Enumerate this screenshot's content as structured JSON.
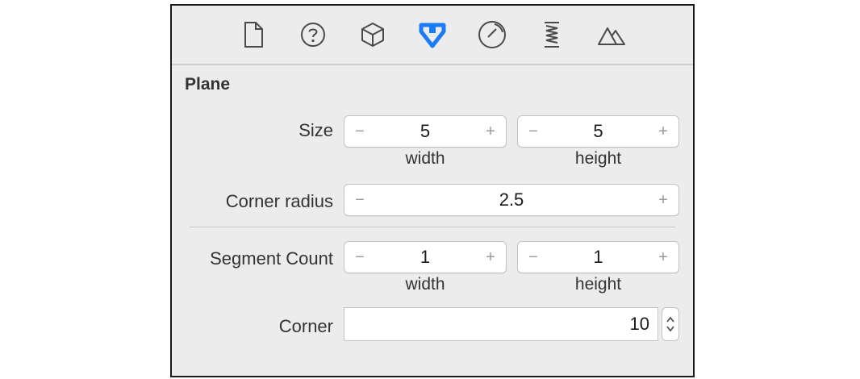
{
  "toolbar": {
    "tabs": [
      {
        "icon": "file-icon",
        "active": false
      },
      {
        "icon": "help-icon",
        "active": false
      },
      {
        "icon": "cube-icon",
        "active": false
      },
      {
        "icon": "attributes-arrow-icon",
        "active": true
      },
      {
        "icon": "sphere-icon",
        "active": false
      },
      {
        "icon": "physics-spring-icon",
        "active": false
      },
      {
        "icon": "scene-mountain-icon",
        "active": false
      }
    ],
    "active_color": "#1a7cf5",
    "icon_color": "#4a4a4a"
  },
  "section": {
    "title": "Plane"
  },
  "size": {
    "label": "Size",
    "width_value": "5",
    "height_value": "5",
    "width_label": "width",
    "height_label": "height",
    "minus": "−",
    "plus": "+"
  },
  "corner_radius": {
    "label": "Corner radius",
    "value": "2.5",
    "minus": "−",
    "plus": "+"
  },
  "segment_count": {
    "label": "Segment Count",
    "width_value": "1",
    "height_value": "1",
    "width_label": "width",
    "height_label": "height",
    "minus": "−",
    "plus": "+"
  },
  "corner": {
    "label": "Corner",
    "value": "10"
  }
}
